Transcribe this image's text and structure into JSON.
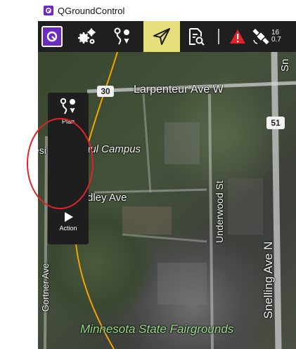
{
  "window": {
    "title": "QGroundControl",
    "accent_color": "#6b2bc0",
    "toolbar_bg": "#1f1f1f",
    "fly_active_color": "#e5df7c"
  },
  "toolbar": {
    "buttons": [
      {
        "name": "qgc-menu",
        "icon": "qgc-logo-icon"
      },
      {
        "name": "vehicle-setup",
        "icon": "gears-icon"
      },
      {
        "name": "plan-view",
        "icon": "plan-waypoint-icon"
      },
      {
        "name": "fly-view",
        "icon": "paper-plane-icon",
        "active": true
      },
      {
        "name": "analyze-view",
        "icon": "document-search-icon"
      }
    ],
    "warning_icon": "warning-triangle-icon",
    "gps": {
      "icon": "satellite-icon",
      "satellite_count": "16",
      "hdop": "0.7"
    }
  },
  "map": {
    "labels": {
      "larpenteur": "Larpenteur Ave W",
      "campus": "aul Campus",
      "campus_prefix": "esi",
      "dley": "dley Ave",
      "underwood": "Underwood St",
      "snelling": "Snelling Ave N",
      "gortner": "Gortner Ave",
      "fairgrounds": "Minnesota State Fairgrounds",
      "sn_top": "Sn"
    },
    "shields": {
      "route30": "30",
      "route51": "51"
    }
  },
  "toolstrip": {
    "plan_label": "Plan",
    "action_label": "Action"
  }
}
